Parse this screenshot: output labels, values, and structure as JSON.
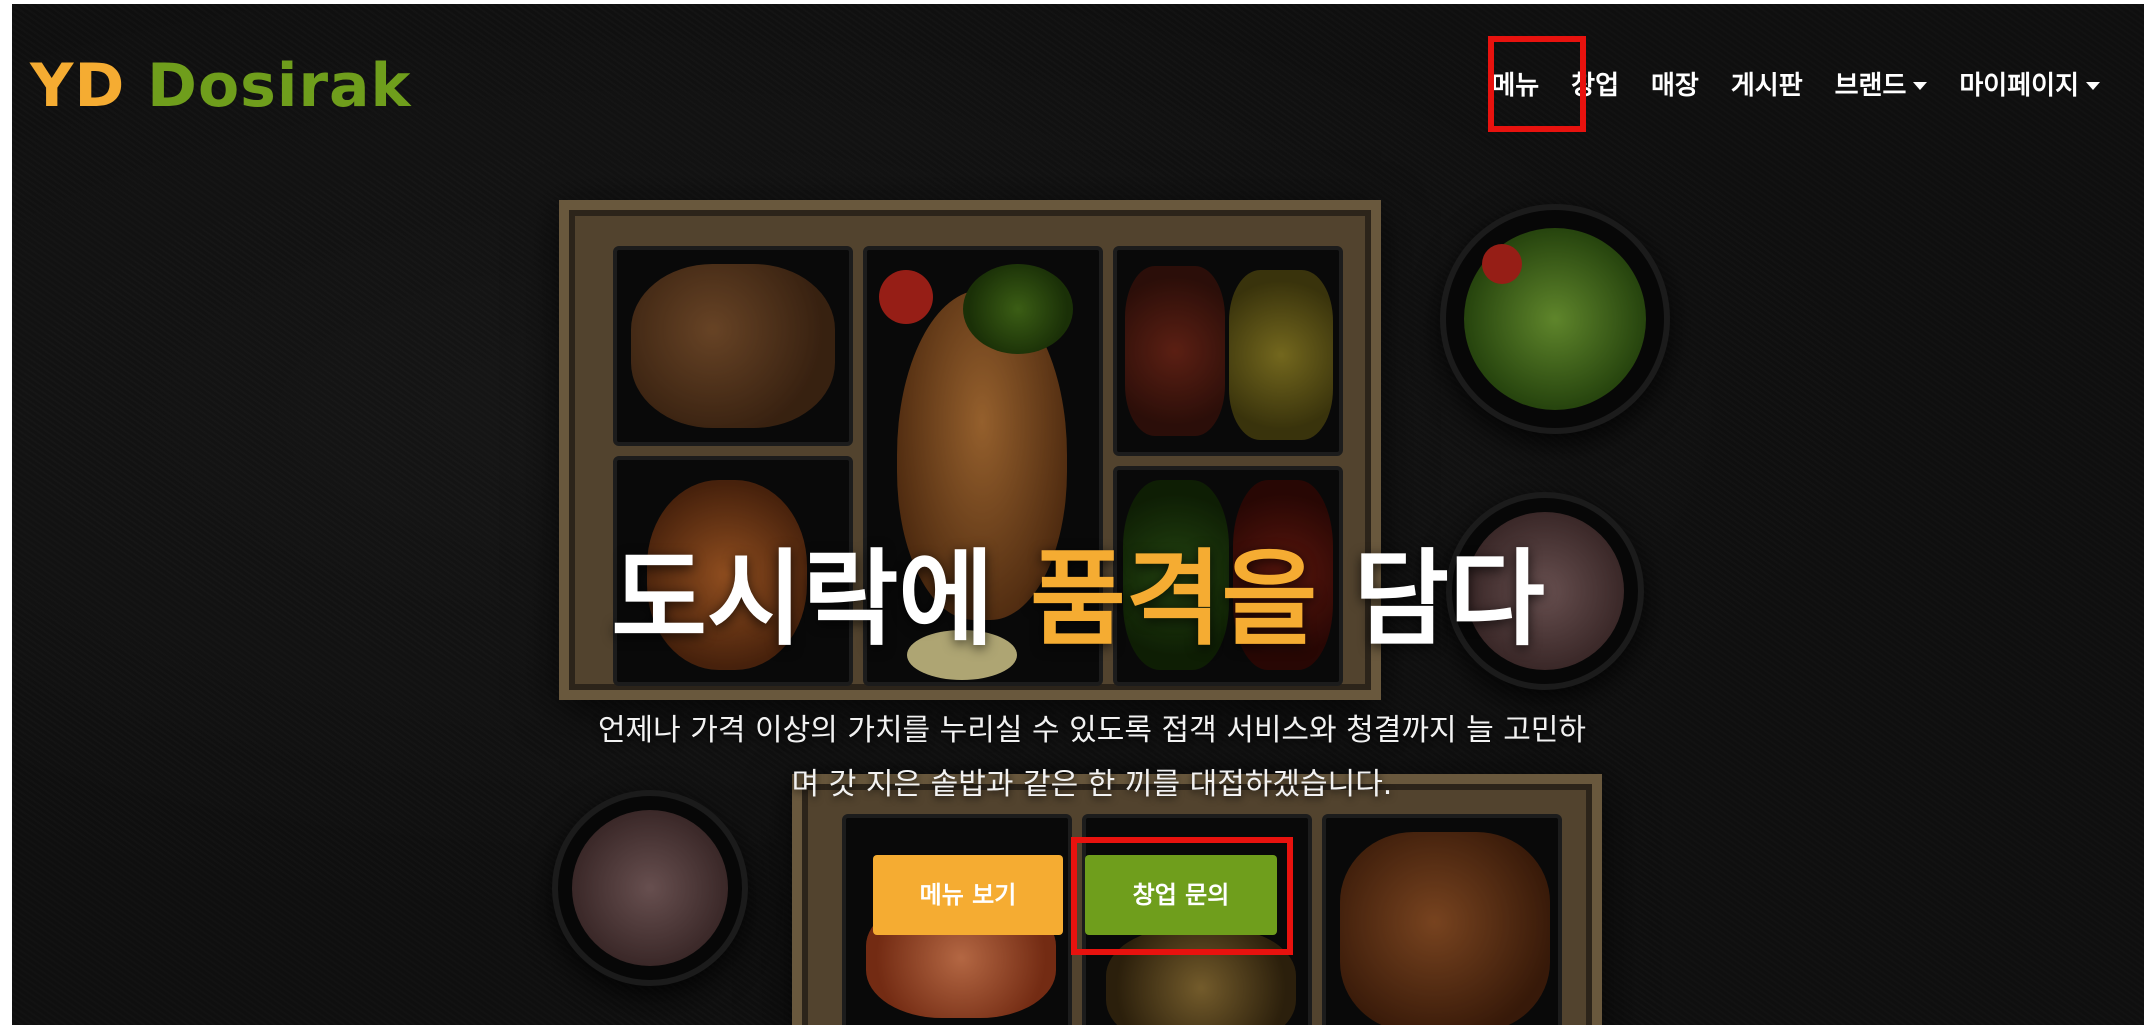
{
  "brand": {
    "part1": "YD",
    "part2": "Dosirak",
    "color_part1": "#f5ac32",
    "color_part2": "#6f9e1c"
  },
  "nav": {
    "items": [
      {
        "label": "메뉴"
      },
      {
        "label": "창업",
        "highlighted": true
      },
      {
        "label": "매장"
      },
      {
        "label": "게시판"
      },
      {
        "label": "브랜드",
        "dropdown": true
      },
      {
        "label": "마이페이지",
        "dropdown": true
      }
    ]
  },
  "hero": {
    "title_part1": "도시락에",
    "title_accent": "품격을",
    "title_part2": "담다",
    "desc_line1": "언제나 가격 이상의 가치를 누리실 수 있도록 접객 서비스와 청결까지 늘 고민하",
    "desc_line2": "며 갓 지은 솥밥과 같은 한 끼를 대접하겠습니다.",
    "btn_menu": "메뉴 보기",
    "btn_startup": "창업 문의"
  },
  "annotation_color": "#e8120e",
  "icons": [
    "caret-down-icon"
  ]
}
